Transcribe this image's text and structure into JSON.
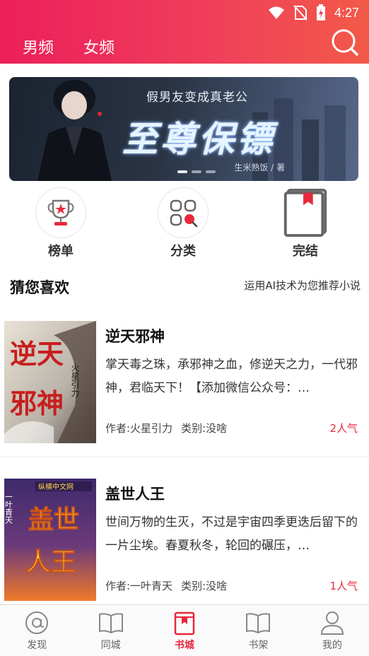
{
  "status": {
    "time": "4:27"
  },
  "header": {
    "tabs": [
      {
        "label": "男频"
      },
      {
        "label": "女频"
      }
    ]
  },
  "banner": {
    "subtitle": "假男友变成真老公",
    "title": "至尊保镖",
    "author": "生米熟饭 / 著",
    "slides": 3,
    "active_slide": 1
  },
  "categories": [
    {
      "label": "榜单",
      "icon": "trophy-icon"
    },
    {
      "label": "分类",
      "icon": "grid-search-icon"
    },
    {
      "label": "完结",
      "icon": "book-bookmark-icon"
    }
  ],
  "section": {
    "title": "猜您喜欢",
    "subtitle": "运用AI技术为您推荐小说"
  },
  "books": [
    {
      "title": "逆天邪神",
      "description": "掌天毒之珠，承邪神之血，修逆天之力，一代邪神，君临天下！【添加微信公众号：…",
      "author": "作者:火星引力",
      "category": "类别:没啥",
      "popularity": "2人气",
      "cover_text": "逆天邪神",
      "cover_sub": "火星引力"
    },
    {
      "title": "盖世人王",
      "description": "世间万物的生灭，不过是宇宙四季更迭后留下的一片尘埃。春夏秋冬，轮回的碾压，…",
      "author": "作者:一叶青天",
      "category": "类别:没啥",
      "popularity": "1人气",
      "cover_text": "盖世人王",
      "cover_sub": "一叶青天",
      "cover_badge": "纵横中文网"
    }
  ],
  "bottom_nav": [
    {
      "label": "发现",
      "icon": "at-circle-icon"
    },
    {
      "label": "同城",
      "icon": "open-book-icon"
    },
    {
      "label": "书城",
      "icon": "bookstore-icon",
      "active": true
    },
    {
      "label": "书架",
      "icon": "bookshelf-icon"
    },
    {
      "label": "我的",
      "icon": "person-icon"
    }
  ],
  "colors": {
    "accent": "#e8283c",
    "header_start": "#ec1f5a",
    "header_end": "#f25a48"
  }
}
